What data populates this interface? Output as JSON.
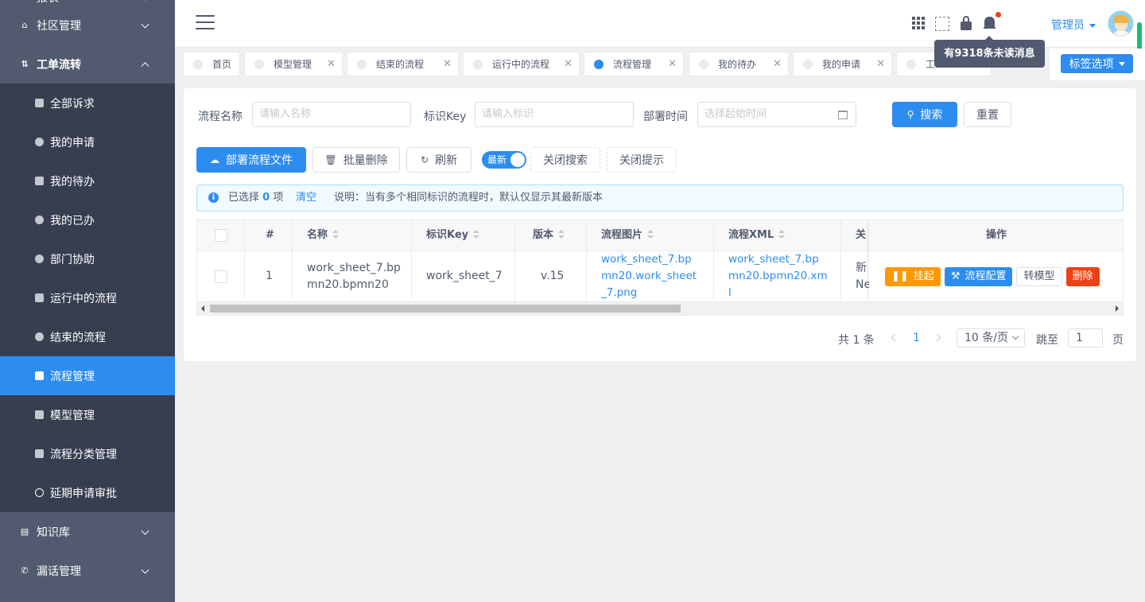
{
  "sidebar": {
    "top_item": "报表",
    "items": [
      {
        "label": "社区管理"
      },
      {
        "label": "工单流转"
      }
    ],
    "sub_items": [
      {
        "label": "全部诉求"
      },
      {
        "label": "我的申请"
      },
      {
        "label": "我的待办"
      },
      {
        "label": "我的已办"
      },
      {
        "label": "部门协助"
      },
      {
        "label": "运行中的流程"
      },
      {
        "label": "结束的流程"
      },
      {
        "label": "流程管理"
      },
      {
        "label": "模型管理"
      },
      {
        "label": "流程分类管理"
      },
      {
        "label": "延期申请审批"
      }
    ],
    "bottom_items": [
      {
        "label": "知识库"
      },
      {
        "label": "漏话管理"
      }
    ]
  },
  "header": {
    "user_name": "管理员",
    "tooltip": "有9318条未读消息"
  },
  "tabs": [
    {
      "label": "首页"
    },
    {
      "label": "模型管理"
    },
    {
      "label": "结束的流程"
    },
    {
      "label": "运行中的流程"
    },
    {
      "label": "流程管理"
    },
    {
      "label": "我的待办"
    },
    {
      "label": "我的申请"
    },
    {
      "label": "工"
    }
  ],
  "tag_options_label": "标签选项",
  "search": {
    "name_label": "流程名称",
    "name_placeholder": "请输入名称",
    "key_label": "标识Key",
    "key_placeholder": "请输入标识",
    "time_label": "部署时间",
    "time_placeholder": "选择起始时间",
    "search_btn": "搜索",
    "reset_btn": "重置"
  },
  "toolbar": {
    "deploy_btn": "部署流程文件",
    "batch_delete_btn": "批量删除",
    "refresh_btn": "刷新",
    "switch_label": "最新",
    "close_search_btn": "关闭搜索",
    "close_tip_btn": "关闭提示"
  },
  "alert": {
    "selected_prefix": "已选择",
    "selected_count": "0",
    "selected_suffix": "项",
    "clear": "清空",
    "note": "说明：当有多个相同标识的流程时，默认仅显示其最新版本"
  },
  "table": {
    "headers": [
      "#",
      "名称",
      "标识Key",
      "版本",
      "流程图片",
      "流程XML",
      "关",
      "操作"
    ],
    "rows": [
      {
        "index": "1",
        "name": "work_sheet_7.bpmn20.bpmn20",
        "key": "work_sheet_7",
        "version": "v.15",
        "image": "work_sheet_7.bpmn20.work_sheet_7.png",
        "xml": "work_sheet_7.bpmn20.bpmn20.xml",
        "related_1": "新",
        "related_2": "Ne"
      }
    ],
    "actions": {
      "suspend": "挂起",
      "config": "流程配置",
      "to_model": "转模型",
      "delete": "删除"
    }
  },
  "pagination": {
    "total": "共 1 条",
    "current_page": "1",
    "page_size": "10 条/页",
    "jump_label": "跳至",
    "jump_value": "1",
    "page_suffix": "页"
  },
  "colors": {
    "primary": "#2d8cf0",
    "warning": "#ff9900",
    "error": "#ed4014",
    "sidebar_bg": "#515a6e",
    "sidebar_sub_bg": "#363e4f"
  }
}
